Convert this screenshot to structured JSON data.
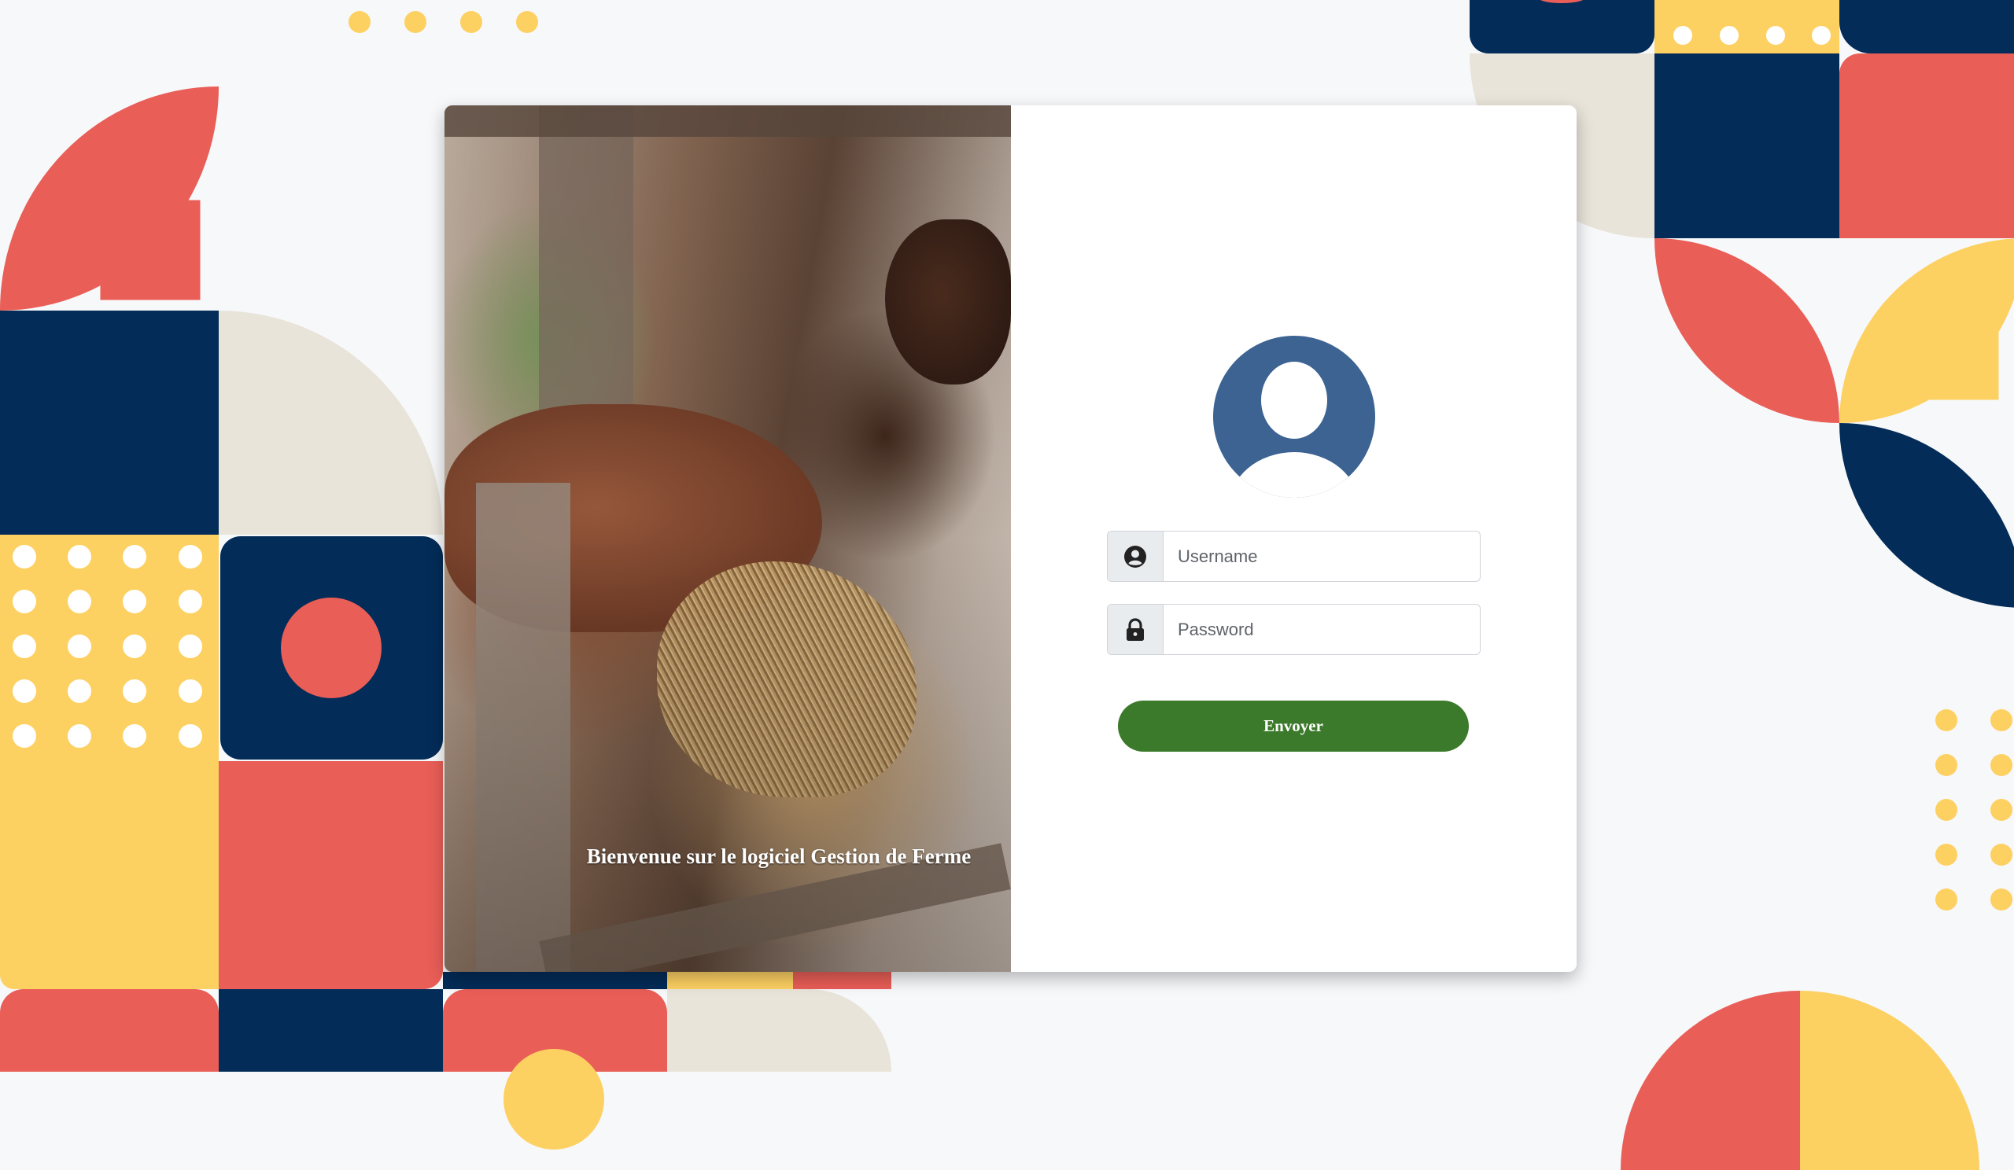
{
  "welcome_text": "Bienvenue sur le logiciel Gestion de Ferme",
  "username": {
    "placeholder": "Username",
    "icon": "user-circle-icon"
  },
  "password": {
    "placeholder": "Password",
    "icon": "lock-icon"
  },
  "submit_label": "Envoyer",
  "colors": {
    "navy": "#032c58",
    "coral": "#e95e57",
    "yellow": "#fdd062",
    "cream": "#e9e4da",
    "avatar_blue": "#3c6392",
    "button_green": "#3c7a2b"
  }
}
